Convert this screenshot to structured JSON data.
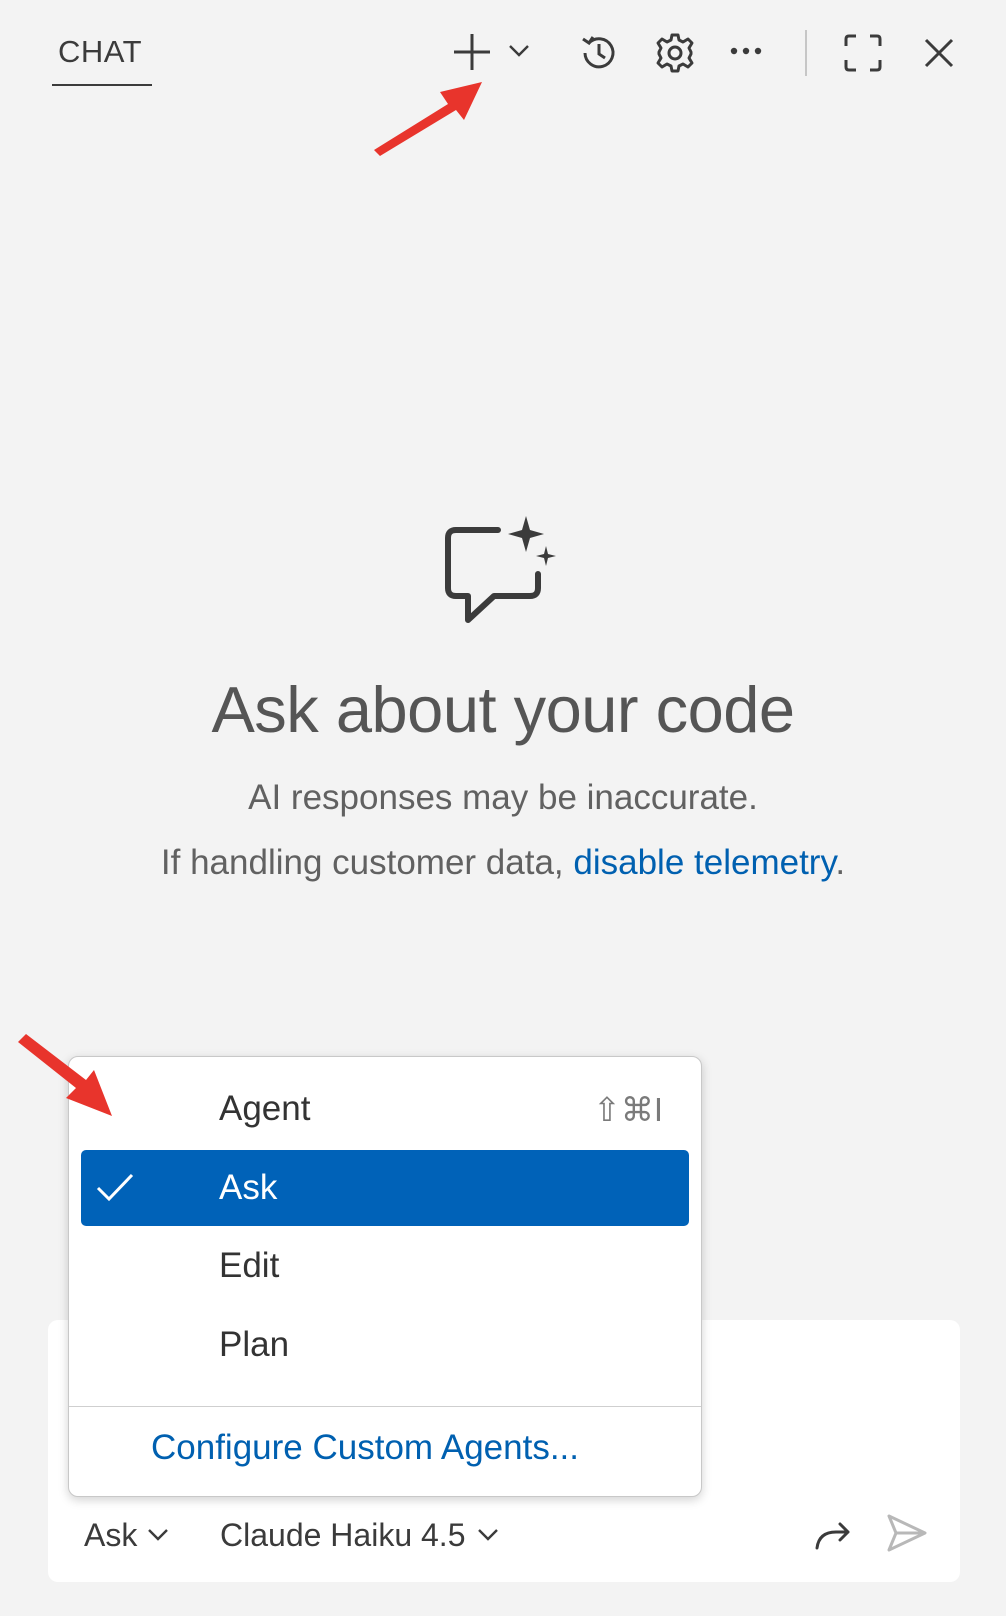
{
  "header": {
    "tab_label": "CHAT",
    "icons": [
      "add-icon",
      "chevron-down-icon",
      "history-icon",
      "gear-icon",
      "more-icon",
      "maximize-icon",
      "close-icon"
    ]
  },
  "welcome": {
    "title": "Ask about your code",
    "line1": "AI responses may be inaccurate.",
    "line2_prefix": "If handling customer data, ",
    "line2_link": "disable telemetry",
    "line2_suffix": "."
  },
  "mode_menu": {
    "items": [
      {
        "label": "Agent",
        "shortcut": "⇧⌘I",
        "selected": false
      },
      {
        "label": "Ask",
        "shortcut": "",
        "selected": true
      },
      {
        "label": "Edit",
        "shortcut": "",
        "selected": false
      },
      {
        "label": "Plan",
        "shortcut": "",
        "selected": false
      }
    ],
    "configure_label": "Configure Custom Agents..."
  },
  "input": {
    "mode_label": "Ask",
    "model_label": "Claude Haiku 4.5"
  },
  "colors": {
    "background": "#f3f3f3",
    "selected": "#0062b8",
    "link": "#0060b0",
    "annotation_arrow": "#e8342c"
  }
}
